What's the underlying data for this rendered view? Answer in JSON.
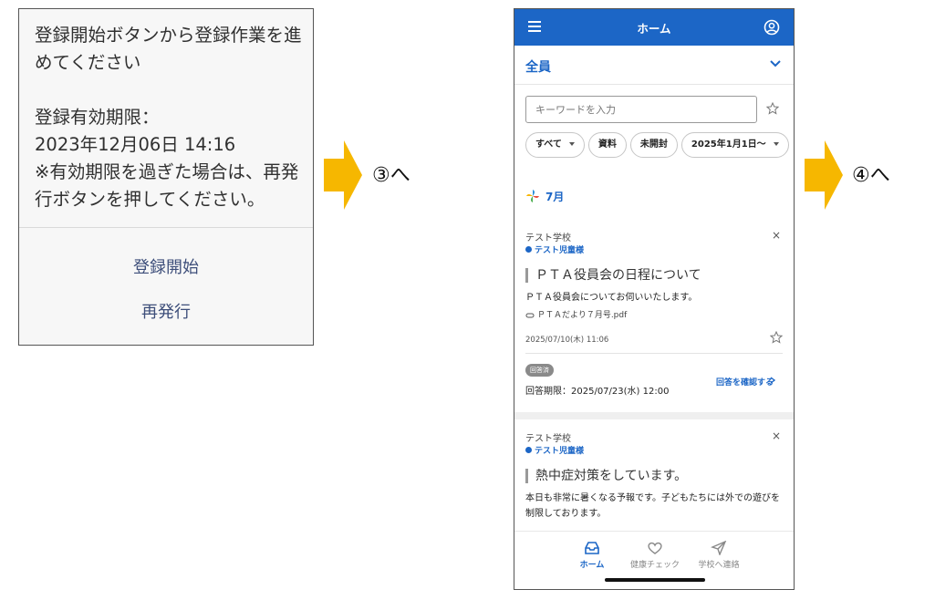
{
  "dialog": {
    "message_lines": [
      "登録開始ボタンから登録作業を進",
      "めてください"
    ],
    "expiry_label": "登録有効期限：",
    "expiry_value": "2023年12月06日 14:16",
    "note_lines": [
      "※有効期限を過ぎた場合は、再発",
      "行ボタンを押してください。"
    ],
    "start_button": "登録開始",
    "reissue_button": "再発行"
  },
  "steps": {
    "step3": "③へ",
    "step4": "④へ"
  },
  "colors": {
    "brand": "#1c66c6",
    "arrow": "#f6b700"
  },
  "phone": {
    "appbar": {
      "menu_icon": "hamburger-menu-icon",
      "title": "ホーム",
      "account_icon": "account-circle-icon"
    },
    "group": {
      "label": "全員",
      "icon": "chevron-down-icon"
    },
    "search": {
      "placeholder": "キーワードを入力",
      "icon": "star-outline-icon"
    },
    "chips": [
      "すべて",
      "資料",
      "未開封",
      "2025年1月1日～"
    ],
    "month_label": "7月",
    "cards": [
      {
        "school": "テスト学校",
        "child": "テスト児童様",
        "title": "ＰＴＡ役員会の日程について",
        "body": "ＰＴＡ役員会についてお伺いいたします。",
        "attachment": "ＰＴＡだより７月号.pdf",
        "date": "2025/07/10(木) 11:06",
        "badge": "回答済",
        "deadline": "回答期限：2025/07/23(水) 12:00",
        "confirm_link": "回答を確認する"
      },
      {
        "school": "テスト学校",
        "child": "テスト児童様",
        "title": "熱中症対策をしています。",
        "body": "本日も非常に暑くなる予報です。子どもたちには外での遊びを制限しております。"
      }
    ],
    "nav": [
      {
        "label": "ホーム",
        "icon": "inbox-icon",
        "active": true
      },
      {
        "label": "健康チェック",
        "icon": "heart-icon",
        "active": false
      },
      {
        "label": "学校へ連絡",
        "icon": "send-icon",
        "active": false
      }
    ]
  }
}
